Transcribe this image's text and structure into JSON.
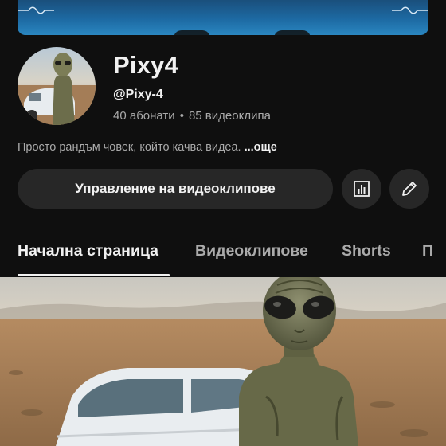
{
  "channel": {
    "name": "Pixy4",
    "handle": "@Pixy-4",
    "subscribers": "40 абонати",
    "separator": "•",
    "videos": "85 видеоклипа",
    "description": "Просто рандъм човек, който качва видеа.",
    "more_label": "...още"
  },
  "actions": {
    "manage_label": "Управление на видеоклипове",
    "stats_icon": "analytics-icon",
    "edit_icon": "pencil-icon"
  },
  "tabs": [
    {
      "label": "Начална страница",
      "active": true
    },
    {
      "label": "Видеоклипове",
      "active": false
    },
    {
      "label": "Shorts",
      "active": false
    },
    {
      "label": "П",
      "active": false
    }
  ],
  "colors": {
    "background": "#0f0f0f",
    "button_bg": "#272727",
    "text_primary": "#f1f1f1",
    "text_secondary": "#aaaaaa",
    "banner_blue": "#1d6aa3"
  }
}
